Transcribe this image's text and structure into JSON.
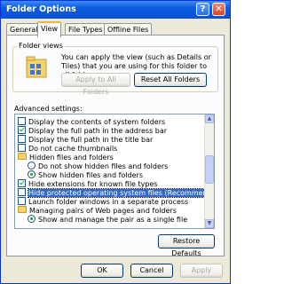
{
  "window": {
    "title": "Folder Options",
    "help": "?",
    "close": "✕"
  },
  "tabs": [
    "General",
    "View",
    "File Types",
    "Offline Files"
  ],
  "folder_views": {
    "legend": "Folder views",
    "description": "You can apply the view (such as Details or Tiles) that you are using for this folder to all folders.",
    "apply_label": "Apply to All Folders",
    "reset_label": "Reset All Folders"
  },
  "advanced": {
    "label": "Advanced settings:",
    "items": [
      {
        "type": "checkbox",
        "checked": false,
        "label": "Display the contents of system folders"
      },
      {
        "type": "checkbox",
        "checked": true,
        "label": "Display the full path in the address bar"
      },
      {
        "type": "checkbox",
        "checked": false,
        "label": "Display the full path in the title bar"
      },
      {
        "type": "checkbox",
        "checked": false,
        "label": "Do not cache thumbnails"
      },
      {
        "type": "folder",
        "label": "Hidden files and folders"
      },
      {
        "type": "radio",
        "checked": false,
        "label": "Do not show hidden files and folders",
        "indent": true
      },
      {
        "type": "radio",
        "checked": true,
        "label": "Show hidden files and folders",
        "indent": true
      },
      {
        "type": "checkbox",
        "checked": true,
        "label": "Hide extensions for known file types"
      },
      {
        "type": "checkbox",
        "checked": false,
        "label": "Hide protected operating system files (Recommended)",
        "selected": true
      },
      {
        "type": "checkbox",
        "checked": false,
        "label": "Launch folder windows in a separate process"
      },
      {
        "type": "folder",
        "label": "Managing pairs of Web pages and folders"
      },
      {
        "type": "radio",
        "checked": true,
        "label": "Show and manage the pair as a single file",
        "indent": true
      }
    ],
    "restore_label": "Restore Defaults"
  },
  "footer": {
    "ok": "OK",
    "cancel": "Cancel",
    "apply": "Apply"
  }
}
